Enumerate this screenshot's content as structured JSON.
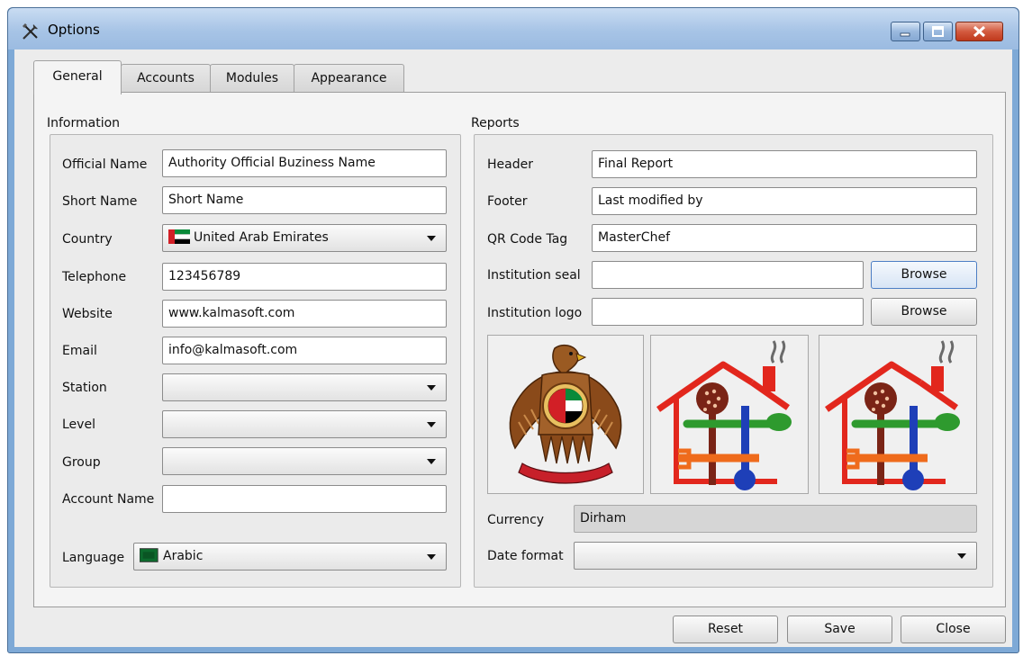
{
  "window": {
    "title": "Options",
    "icon": "tools-icon"
  },
  "tabs": [
    {
      "label": "General",
      "active": true
    },
    {
      "label": "Accounts",
      "active": false
    },
    {
      "label": "Modules",
      "active": false
    },
    {
      "label": "Appearance",
      "active": false
    }
  ],
  "information": {
    "title": "Information",
    "official_name": {
      "label": "Official Name",
      "value": "Authority Official Buziness Name"
    },
    "short_name": {
      "label": "Short Name",
      "value": "Short Name"
    },
    "country": {
      "label": "Country",
      "value": "United Arab Emirates",
      "icon": "uae-flag-icon"
    },
    "telephone": {
      "label": "Telephone",
      "value": "123456789"
    },
    "website": {
      "label": "Website",
      "value": "www.kalmasoft.com"
    },
    "email": {
      "label": "Email",
      "value": "info@kalmasoft.com"
    },
    "station": {
      "label": "Station",
      "value": ""
    },
    "level": {
      "label": "Level",
      "value": ""
    },
    "group": {
      "label": "Group",
      "value": ""
    },
    "account_name": {
      "label": "Account Name",
      "value": ""
    },
    "language": {
      "label": "Language",
      "value": "Arabic",
      "icon": "arabic-flag-icon"
    }
  },
  "reports": {
    "title": "Reports",
    "header": {
      "label": "Header",
      "value": "Final Report"
    },
    "footer": {
      "label": "Footer",
      "value": "Last modified by"
    },
    "qr_code_tag": {
      "label": "QR Code Tag",
      "value": "MasterChef"
    },
    "institution_seal": {
      "label": "Institution seal",
      "value": "",
      "button": "Browse"
    },
    "institution_logo": {
      "label": "Institution logo",
      "value": "",
      "button": "Browse"
    },
    "images": [
      "uae-emblem-icon",
      "kitchen-house-logo-icon",
      "kitchen-house-logo-icon"
    ],
    "currency": {
      "label": "Currency",
      "value": "Dirham"
    },
    "date_format": {
      "label": "Date format",
      "value": ""
    }
  },
  "footer_buttons": {
    "reset": "Reset",
    "save": "Save",
    "close": "Close"
  },
  "colors": {
    "title_bar": "#a7c4e6",
    "close_button": "#c0391c",
    "focus_border": "#4d7ec4"
  }
}
